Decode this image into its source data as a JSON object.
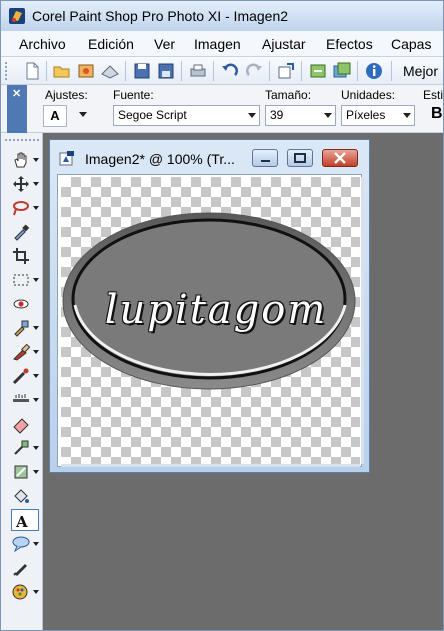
{
  "window": {
    "title": "Corel Paint Shop Pro Photo XI - Imagen2"
  },
  "menu": {
    "items": [
      {
        "label": "Archivo"
      },
      {
        "label": "Edición"
      },
      {
        "label": "Ver"
      },
      {
        "label": "Imagen"
      },
      {
        "label": "Ajustar"
      },
      {
        "label": "Efectos"
      },
      {
        "label": "Capas"
      }
    ]
  },
  "toolbar": {
    "buttons": [
      "new-icon",
      "open-icon",
      "browse-icon",
      "scan-icon",
      "save-icon",
      "save-as-icon",
      "print-icon",
      "undo-icon",
      "redo-icon",
      "resize-icon",
      "refresh-icon",
      "batch-icon",
      "info-icon"
    ],
    "label": "Mejor"
  },
  "options": {
    "adjust_label": "Ajustes:",
    "adjust_value": "A",
    "font_label": "Fuente:",
    "font_value": "Segoe Script",
    "size_label": "Tamaño:",
    "size_value": "39",
    "units_label": "Unidades:",
    "units_value": "Píxeles",
    "style_label": "Esti",
    "bold_label": "B"
  },
  "tools": [
    "pan-icon",
    "move-icon",
    "freehand-select-icon",
    "dropper-icon",
    "crop-icon",
    "selection-icon",
    "red-eye-icon",
    "clone-icon",
    "paint-brush-icon",
    "airbrush-icon",
    "scratch-remover-icon",
    "eraser-icon",
    "lighten-darken-icon",
    "smudge-icon",
    "fill-icon",
    "text-icon",
    "preset-shape-icon",
    "pen-icon",
    "picture-tube-icon"
  ],
  "document": {
    "title": "Imagen2* @ 100% (Tr...",
    "graphic_text": "lupitagom"
  },
  "colors": {
    "titlebar": "#bfd4ec",
    "workspace": "#6c6c6c",
    "oval_fill": "#7a7a7a",
    "close_button": "#c4402b"
  }
}
